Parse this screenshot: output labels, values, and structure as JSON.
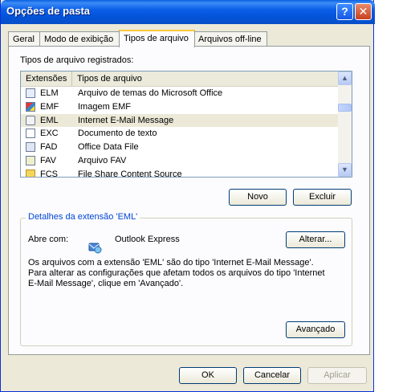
{
  "window": {
    "title": "Opções de pasta"
  },
  "title_buttons": {
    "help": "?",
    "close": "✕"
  },
  "tabs": [
    {
      "label": "Geral"
    },
    {
      "label": "Modo de exibição"
    },
    {
      "label": "Tipos de arquivo"
    },
    {
      "label": "Arquivos off-line"
    }
  ],
  "file_types": {
    "label": "Tipos de arquivo registrados:",
    "columns": [
      "Extensões",
      "Tipos de arquivo"
    ],
    "rows": [
      {
        "ext": "ELM",
        "type": "Arquivo de temas do Microsoft Office",
        "icon": "office-theme-icon"
      },
      {
        "ext": "EMF",
        "type": "Imagem EMF",
        "icon": "image-icon"
      },
      {
        "ext": "EML",
        "type": "Internet E-Mail Message",
        "icon": "email-message-icon"
      },
      {
        "ext": "EXC",
        "type": "Documento de texto",
        "icon": "text-document-icon"
      },
      {
        "ext": "FAD",
        "type": "Office Data File",
        "icon": "data-file-icon"
      },
      {
        "ext": "FAV",
        "type": "Arquivo FAV",
        "icon": "file-icon"
      },
      {
        "ext": "FCS",
        "type": "File Share Content Source",
        "icon": "folder-icon"
      }
    ],
    "selected_index": 2
  },
  "buttons": {
    "new": "Novo",
    "delete": "Excluir",
    "change": "Alterar...",
    "advanced": "Avançado",
    "ok": "OK",
    "cancel": "Cancelar",
    "apply": "Aplicar"
  },
  "details": {
    "legend": "Detalhes da extensão 'EML'",
    "opens_with_label": "Abre com:",
    "app_name": "Outlook Express",
    "description": "Os arquivos com a extensão 'EML' são do tipo 'Internet E-Mail Message'. Para alterar as configurações que afetam todos os arquivos do tipo 'Internet E-Mail Message', clique em 'Avançado'."
  }
}
